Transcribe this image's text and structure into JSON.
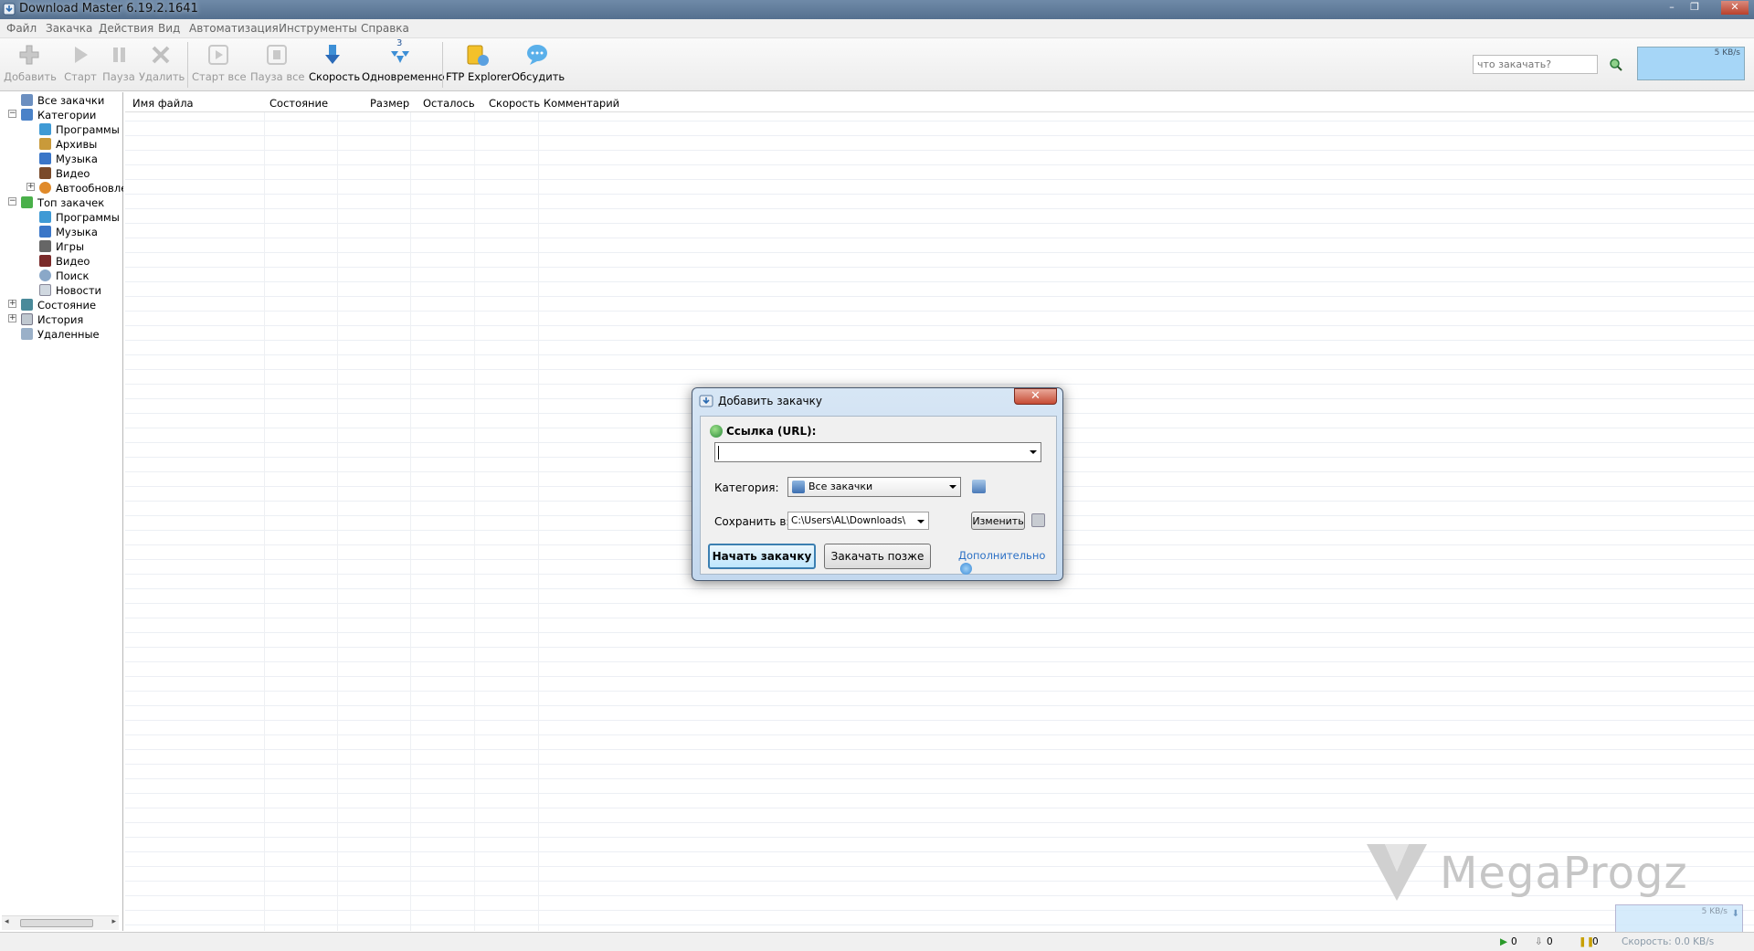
{
  "window": {
    "title": "Download Master 6.19.2.1641",
    "min": "–",
    "max": "❐",
    "close": "✕"
  },
  "menu": [
    "Файл",
    "Закачка",
    "Действия",
    "Вид",
    "Автоматизация",
    "Инструменты",
    "Справка"
  ],
  "toolbar": {
    "add": "Добавить",
    "start": "Старт",
    "pause": "Пауза",
    "delete": "Удалить",
    "start_all": "Старт все",
    "pause_all": "Пауза все",
    "speed": "Скорость",
    "simultaneous": "Одновременно",
    "simultaneous_count": "3",
    "ftp": "FTP Explorer",
    "discuss": "Обсудить"
  },
  "search": {
    "placeholder": "что закачать?"
  },
  "speed_graph": {
    "label": "5 KB/s"
  },
  "tree": {
    "all": "Все закачки",
    "categories": "Категории",
    "cat_items": [
      "Программы",
      "Архивы",
      "Музыка",
      "Видео",
      "Автообновле"
    ],
    "top": "Топ закачек",
    "top_items": [
      "Программы",
      "Музыка",
      "Игры",
      "Видео",
      "Поиск",
      "Новости"
    ],
    "state": "Состояние",
    "history": "История",
    "deleted": "Удаленные"
  },
  "columns": [
    "Имя файла",
    "Состояние",
    "Размер",
    "Осталось",
    "Скорость",
    "Комментарий"
  ],
  "dialog": {
    "title": "Добавить закачку",
    "url_label": "Ссылка (URL):",
    "url_value": "",
    "category_label": "Категория:",
    "category_value": "Все закачки",
    "save_label": "Сохранить в:",
    "save_value": "C:\\Users\\AL\\Downloads\\",
    "change": "Изменить",
    "start_now": "Начать закачку",
    "later": "Закачать позже",
    "more": "Дополнительно"
  },
  "statusbar": {
    "active": "0",
    "queued": "0",
    "paused": "0"
  },
  "watermark": "MegaProgz",
  "tray": {
    "label": "5 KB/s",
    "speed": "Скорость: 0.0 KB/s"
  }
}
